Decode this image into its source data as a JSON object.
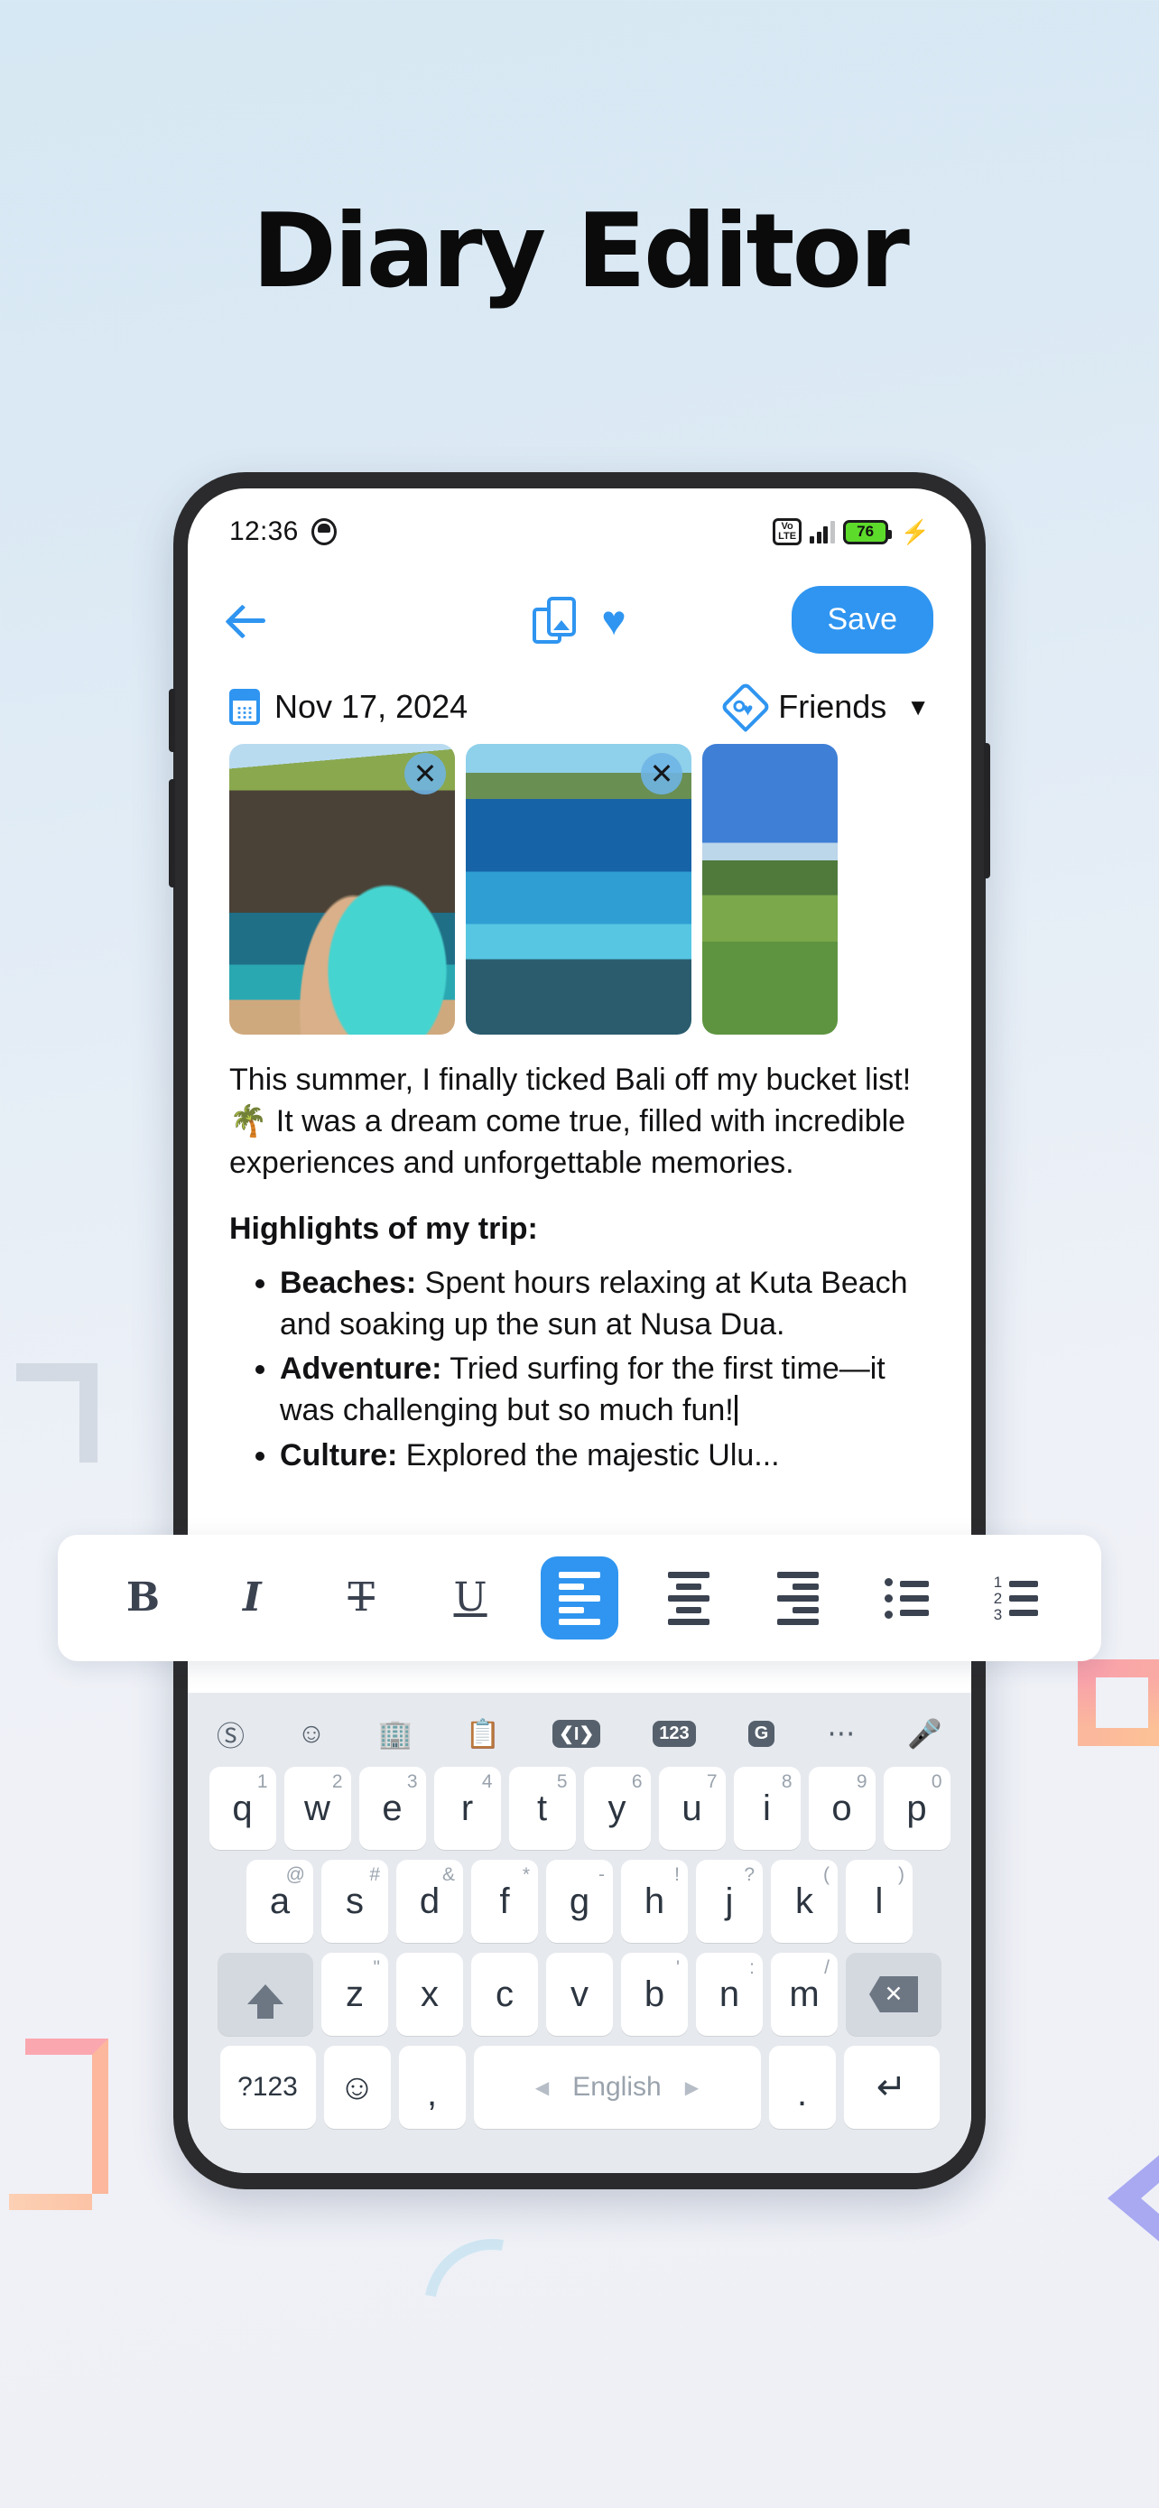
{
  "page": {
    "title": "Diary Editor"
  },
  "status_bar": {
    "time": "12:36",
    "face_icon": "face-icon",
    "volte_line1": "Vo",
    "volte_line2": "LTE",
    "battery_percent": "76",
    "charging_icon": "charging-bolt-icon"
  },
  "app_header": {
    "back_icon": "back-arrow-icon",
    "gallery_icon": "gallery-icon",
    "favorite_icon": "heart-icon",
    "save_label": "Save"
  },
  "meta": {
    "calendar_icon": "calendar-icon",
    "date": "Nov 17, 2024",
    "tag_icon": "tag-icon",
    "tag_label": "Friends",
    "caret": "▼"
  },
  "photos": {
    "remove_glyph": "✕",
    "items": [
      {
        "alt": "Cliff coastline with turquoise water"
      },
      {
        "alt": "Blue ocean waves over reef"
      },
      {
        "alt": "Green field with palm trees"
      }
    ]
  },
  "note": {
    "paragraph": "This summer, I finally ticked Bali off my bucket list! 🌴 It was a dream come true, filled with incredible experiences and unforgettable memories.",
    "highlights_heading": "Highlights of my trip:",
    "bullets": [
      {
        "label": "Beaches:",
        "text": " Spent hours relaxing at Kuta Beach and soaking up the sun at Nusa Dua."
      },
      {
        "label": "Adventure:",
        "text": " Tried surfing for the first time—it was challenging but so much fun!"
      },
      {
        "label": "Culture:",
        "text": " Explored the majestic Ulu..."
      }
    ]
  },
  "format_toolbar": {
    "active": "align-left",
    "buttons": [
      {
        "name": "bold",
        "glyph": "B"
      },
      {
        "name": "italic",
        "glyph": "I"
      },
      {
        "name": "strikethrough",
        "glyph": "T"
      },
      {
        "name": "underline",
        "glyph": "U"
      },
      {
        "name": "align-left",
        "glyph": ""
      },
      {
        "name": "align-center",
        "glyph": ""
      },
      {
        "name": "align-right",
        "glyph": ""
      },
      {
        "name": "bullet-list",
        "glyph": ""
      },
      {
        "name": "numbered-list",
        "glyph": ""
      }
    ]
  },
  "keyboard": {
    "tools": [
      {
        "name": "translate-icon",
        "glyph": "T"
      },
      {
        "name": "sticker-icon",
        "glyph": "☺"
      },
      {
        "name": "store-icon",
        "glyph": "🏪"
      },
      {
        "name": "clipboard-icon",
        "glyph": "📋"
      },
      {
        "name": "text-edit-icon",
        "glyph": "I"
      },
      {
        "name": "numbers-icon",
        "glyph": "123"
      },
      {
        "name": "grammarly-icon",
        "glyph": "G"
      },
      {
        "name": "more-icon",
        "glyph": "•••"
      },
      {
        "name": "mic-icon",
        "glyph": "🎤"
      }
    ],
    "row1": [
      {
        "key": "q",
        "hint": "1"
      },
      {
        "key": "w",
        "hint": "2"
      },
      {
        "key": "e",
        "hint": "3"
      },
      {
        "key": "r",
        "hint": "4"
      },
      {
        "key": "t",
        "hint": "5"
      },
      {
        "key": "y",
        "hint": "6"
      },
      {
        "key": "u",
        "hint": "7"
      },
      {
        "key": "i",
        "hint": "8"
      },
      {
        "key": "o",
        "hint": "9"
      },
      {
        "key": "p",
        "hint": "0"
      }
    ],
    "row2": [
      {
        "key": "a",
        "hint": "@"
      },
      {
        "key": "s",
        "hint": "#"
      },
      {
        "key": "d",
        "hint": "&"
      },
      {
        "key": "f",
        "hint": "*"
      },
      {
        "key": "g",
        "hint": "-"
      },
      {
        "key": "h",
        "hint": "!"
      },
      {
        "key": "j",
        "hint": "?"
      },
      {
        "key": "k",
        "hint": "("
      },
      {
        "key": "l",
        "hint": ")"
      }
    ],
    "row3": [
      {
        "key": "z",
        "hint": "\""
      },
      {
        "key": "x",
        "hint": ""
      },
      {
        "key": "c",
        "hint": ""
      },
      {
        "key": "v",
        "hint": ""
      },
      {
        "key": "b",
        "hint": "'"
      },
      {
        "key": "n",
        "hint": ":"
      },
      {
        "key": "m",
        "hint": "/"
      }
    ],
    "shift_icon": "shift-icon",
    "backspace_icon": "backspace-icon",
    "symbols_key": "?123",
    "emoji_key": "☺",
    "comma_key": ",",
    "space_label": "English",
    "space_prev": "◀",
    "space_next": "▶",
    "period_key": ".",
    "enter_icon": "↵"
  }
}
